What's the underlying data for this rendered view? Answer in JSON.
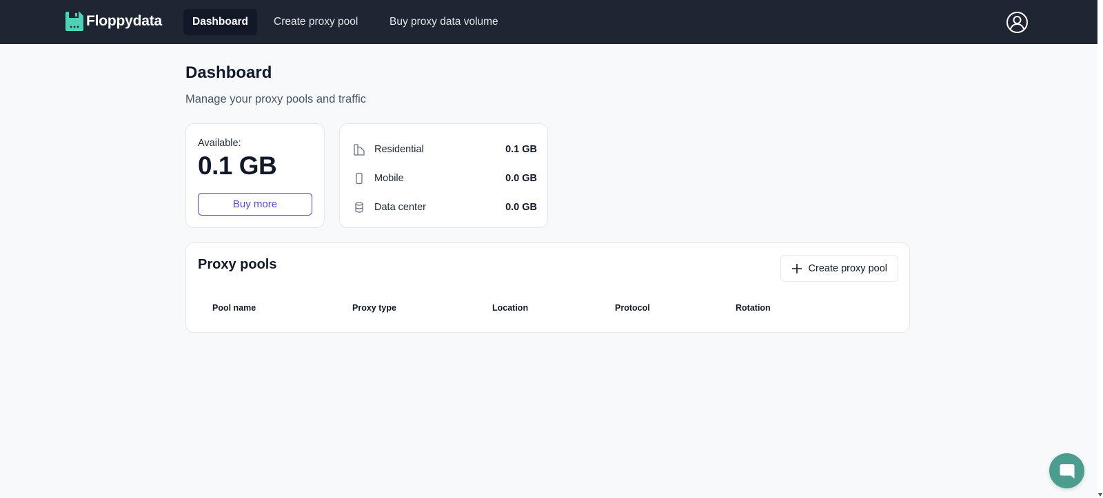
{
  "brand": {
    "name": "Floppydata",
    "accent": "#4fd1b6"
  },
  "nav": {
    "items": [
      {
        "label": "Dashboard",
        "active": true
      },
      {
        "label": "Create proxy pool",
        "active": false
      },
      {
        "label": "Buy proxy data volume",
        "active": false
      }
    ]
  },
  "page": {
    "title": "Dashboard",
    "subtitle": "Manage your proxy pools and traffic"
  },
  "available": {
    "label": "Available:",
    "value": "0.1 GB",
    "button": "Buy more"
  },
  "traffic_types": [
    {
      "icon": "building-icon",
      "label": "Residential",
      "value": "0.1 GB"
    },
    {
      "icon": "mobile-icon",
      "label": "Mobile",
      "value": "0.0 GB"
    },
    {
      "icon": "database-icon",
      "label": "Data center",
      "value": "0.0 GB"
    }
  ],
  "pools": {
    "title": "Proxy pools",
    "create_button": "Create proxy pool",
    "columns": [
      "Pool name",
      "Proxy type",
      "Location",
      "Protocol",
      "Rotation"
    ]
  },
  "colors": {
    "navbar": "#1e2533",
    "primary": "#4f46e5",
    "chat": "#4a9d8f"
  }
}
